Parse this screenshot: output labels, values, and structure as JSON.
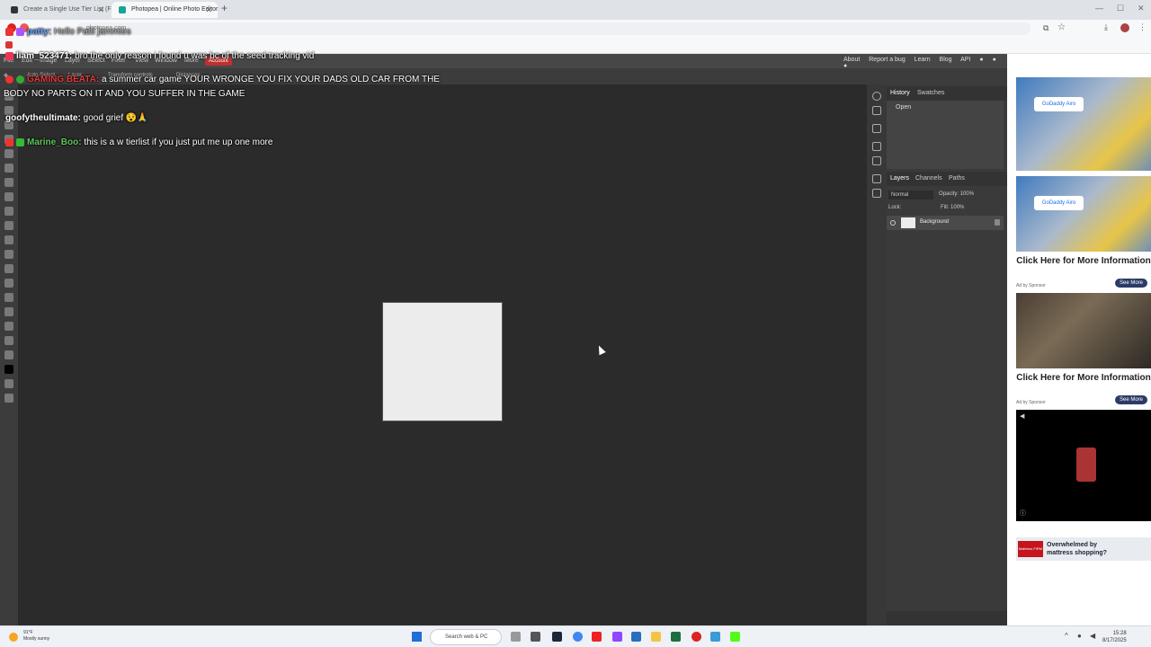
{
  "browser": {
    "tabs": [
      {
        "label": "Create a Single Use Tier List (Fr",
        "active": false
      },
      {
        "label": "Photopea | Online Photo Editor",
        "active": true
      }
    ],
    "url": "photopea.com"
  },
  "photopea": {
    "menus": [
      "File",
      "Edit",
      "Image",
      "Layer",
      "Select",
      "Filter",
      "View",
      "Window",
      "More"
    ],
    "account_label": "Account",
    "toolbar_labels": [
      "Auto-Select",
      "Layer",
      "Transform controls",
      "Distances"
    ],
    "links": [
      "About",
      "Report a bug",
      "Learn",
      "Blog",
      "API"
    ],
    "panels": {
      "top_tabs": [
        "History",
        "Swatches"
      ],
      "history_items": [
        "Open"
      ],
      "layer_tabs": [
        "Layers",
        "Channels",
        "Paths"
      ],
      "blend_mode": "Normal",
      "opacity_label": "Opacity:",
      "opacity_value": "100%",
      "lock_label": "Lock:",
      "fill_label": "Fill:",
      "fill_value": "100%",
      "layer_name": "Background"
    }
  },
  "ads": [
    {
      "title": "",
      "brand": "GoDaddy Airo"
    },
    {
      "title": "Click Here for More Information",
      "brand": "GoDaddy Airo",
      "sponsor": "Ad by Sponsor",
      "button": "See More"
    },
    {
      "title": "Click Here for More Information",
      "sponsor": "Ad by Sponsor",
      "button": "See More"
    }
  ],
  "mattress_ad": {
    "logo": "Mattress FIRM",
    "text": "Overwhelmed by mattress shopping?"
  },
  "chat": [
    {
      "user": "patty:",
      "message": "Hello Patti jammies",
      "color": "#5f9cf5"
    },
    {
      "user": "liam_523471:",
      "message": "bro the only reason i found u was bc of the seed tracking vid",
      "color": "#ffffff"
    },
    {
      "user": "GAMING BEATA:",
      "message": "a summer car game YOUR WRONGE YOU FIX YOUR DADS OLD CAR FROM THE",
      "color": "#e03c3c"
    },
    {
      "user": "",
      "message": "BODY NO PARTS ON IT AND YOU SUFFER IN THE GAME",
      "color": "#ffffff"
    },
    {
      "user": "goofytheultimate:",
      "message": "good grief 😵🙏",
      "color": "#ffffff"
    },
    {
      "user": "Marine_Boo:",
      "message": "this is a w tierlist if you just put me up one more",
      "color": "#5ec75e"
    }
  ],
  "taskbar": {
    "weather_temp": "91°F",
    "weather_desc": "Mostly sunny",
    "search_placeholder": "Search web & PC",
    "time": "15:28",
    "date": "8/17/2025"
  }
}
